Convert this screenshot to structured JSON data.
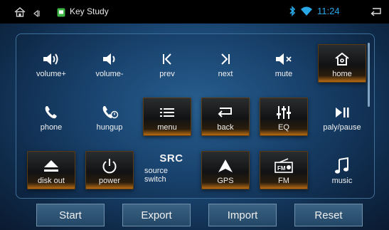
{
  "status_bar": {
    "app_title": "Key Study",
    "time": "11:24",
    "icons": [
      "home-icon",
      "back-nav-icon",
      "app-icon",
      "bluetooth-icon",
      "wifi-icon",
      "return-icon"
    ]
  },
  "keys": [
    {
      "label": "volume+",
      "icon": "volume-up-icon",
      "active": false
    },
    {
      "label": "volume-",
      "icon": "volume-down-icon",
      "active": false
    },
    {
      "label": "prev",
      "icon": "prev-icon",
      "active": false
    },
    {
      "label": "next",
      "icon": "next-icon",
      "active": false
    },
    {
      "label": "mute",
      "icon": "mute-icon",
      "active": false
    },
    {
      "label": "home",
      "icon": "home-icon",
      "active": true
    },
    {
      "label": "phone",
      "icon": "phone-icon",
      "active": false
    },
    {
      "label": "hungup",
      "icon": "hangup-icon",
      "active": false
    },
    {
      "label": "menu",
      "icon": "menu-icon",
      "active": true
    },
    {
      "label": "back",
      "icon": "back-icon",
      "active": true
    },
    {
      "label": "EQ",
      "icon": "equalizer-icon",
      "active": true
    },
    {
      "label": "paly/pause",
      "icon": "play-pause-icon",
      "active": false
    },
    {
      "label": "disk out",
      "icon": "eject-icon",
      "active": true
    },
    {
      "label": "power",
      "icon": "power-icon",
      "active": true
    },
    {
      "label": "source\nswitch",
      "label_line1": "source",
      "label_line2": "switch",
      "icon_text": "SRC",
      "active": false
    },
    {
      "label": "GPS",
      "icon": "gps-icon",
      "active": true
    },
    {
      "label": "FM",
      "icon": "radio-icon",
      "active": true
    },
    {
      "label": "music",
      "icon": "music-icon",
      "active": false
    }
  ],
  "buttons": {
    "start": "Start",
    "export": "Export",
    "import": "Import",
    "reset": "Reset"
  },
  "colors": {
    "accent_time": "#29a8e8",
    "active_glow": "#c87515",
    "bluetooth": "#29a8e8",
    "wifi": "#29a8e8"
  }
}
